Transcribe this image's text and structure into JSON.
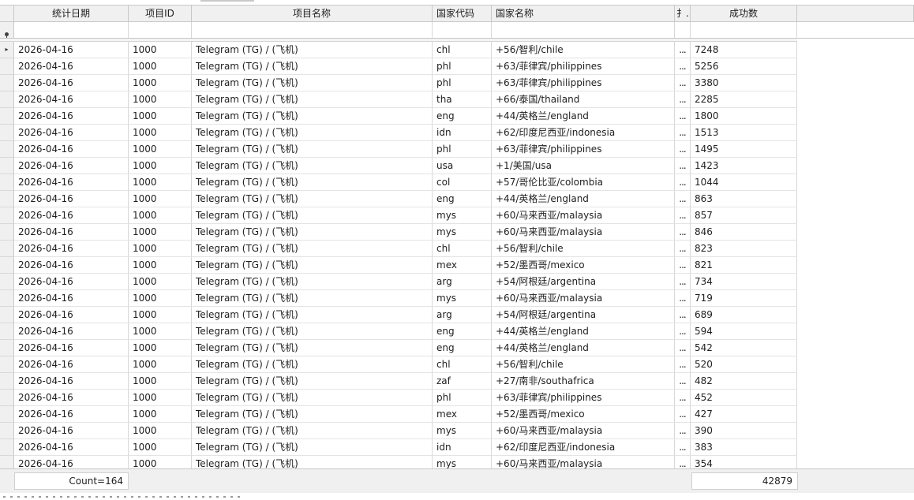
{
  "columns": {
    "date": "统计日期",
    "project_id": "项目ID",
    "project_name": "项目名称",
    "country_code": "国家代码",
    "country_name": "国家名称",
    "truncated": "扌..",
    "success_count": "成功数"
  },
  "rows": [
    {
      "date": "2026-04-16",
      "project_id": "1000",
      "project_name": "Telegram (TG) / (飞机)",
      "country_code": "chl",
      "country_name": "+56/智利/chile",
      "ext": "...",
      "success_count": "7248"
    },
    {
      "date": "2026-04-16",
      "project_id": "1000",
      "project_name": "Telegram (TG) / (飞机)",
      "country_code": "phl",
      "country_name": "+63/菲律宾/philippines",
      "ext": "...",
      "success_count": "5256"
    },
    {
      "date": "2026-04-16",
      "project_id": "1000",
      "project_name": "Telegram (TG) / (飞机)",
      "country_code": "phl",
      "country_name": "+63/菲律宾/philippines",
      "ext": "...",
      "success_count": "3380"
    },
    {
      "date": "2026-04-16",
      "project_id": "1000",
      "project_name": "Telegram (TG) / (飞机)",
      "country_code": "tha",
      "country_name": "+66/泰国/thailand",
      "ext": "...",
      "success_count": "2285"
    },
    {
      "date": "2026-04-16",
      "project_id": "1000",
      "project_name": "Telegram (TG) / (飞机)",
      "country_code": "eng",
      "country_name": "+44/英格兰/england",
      "ext": "...",
      "success_count": "1800"
    },
    {
      "date": "2026-04-16",
      "project_id": "1000",
      "project_name": "Telegram (TG) / (飞机)",
      "country_code": "idn",
      "country_name": "+62/印度尼西亚/indonesia",
      "ext": "...",
      "success_count": "1513"
    },
    {
      "date": "2026-04-16",
      "project_id": "1000",
      "project_name": "Telegram (TG) / (飞机)",
      "country_code": "phl",
      "country_name": "+63/菲律宾/philippines",
      "ext": "...",
      "success_count": "1495"
    },
    {
      "date": "2026-04-16",
      "project_id": "1000",
      "project_name": "Telegram (TG) / (飞机)",
      "country_code": "usa",
      "country_name": "+1/美国/usa",
      "ext": "...",
      "success_count": "1423"
    },
    {
      "date": "2026-04-16",
      "project_id": "1000",
      "project_name": "Telegram (TG) / (飞机)",
      "country_code": "col",
      "country_name": "+57/哥伦比亚/colombia",
      "ext": "...",
      "success_count": "1044"
    },
    {
      "date": "2026-04-16",
      "project_id": "1000",
      "project_name": "Telegram (TG) / (飞机)",
      "country_code": "eng",
      "country_name": "+44/英格兰/england",
      "ext": "...",
      "success_count": "863"
    },
    {
      "date": "2026-04-16",
      "project_id": "1000",
      "project_name": "Telegram (TG) / (飞机)",
      "country_code": "mys",
      "country_name": "+60/马来西亚/malaysia",
      "ext": "...",
      "success_count": "857"
    },
    {
      "date": "2026-04-16",
      "project_id": "1000",
      "project_name": "Telegram (TG) / (飞机)",
      "country_code": "mys",
      "country_name": "+60/马来西亚/malaysia",
      "ext": "...",
      "success_count": "846"
    },
    {
      "date": "2026-04-16",
      "project_id": "1000",
      "project_name": "Telegram (TG) / (飞机)",
      "country_code": "chl",
      "country_name": "+56/智利/chile",
      "ext": "...",
      "success_count": "823"
    },
    {
      "date": "2026-04-16",
      "project_id": "1000",
      "project_name": "Telegram (TG) / (飞机)",
      "country_code": "mex",
      "country_name": "+52/墨西哥/mexico",
      "ext": "...",
      "success_count": "821"
    },
    {
      "date": "2026-04-16",
      "project_id": "1000",
      "project_name": "Telegram (TG) / (飞机)",
      "country_code": "arg",
      "country_name": "+54/阿根廷/argentina",
      "ext": "...",
      "success_count": "734"
    },
    {
      "date": "2026-04-16",
      "project_id": "1000",
      "project_name": "Telegram (TG) / (飞机)",
      "country_code": "mys",
      "country_name": "+60/马来西亚/malaysia",
      "ext": "...",
      "success_count": "719"
    },
    {
      "date": "2026-04-16",
      "project_id": "1000",
      "project_name": "Telegram (TG) / (飞机)",
      "country_code": "arg",
      "country_name": "+54/阿根廷/argentina",
      "ext": "...",
      "success_count": "689"
    },
    {
      "date": "2026-04-16",
      "project_id": "1000",
      "project_name": "Telegram (TG) / (飞机)",
      "country_code": "eng",
      "country_name": "+44/英格兰/england",
      "ext": "...",
      "success_count": "594"
    },
    {
      "date": "2026-04-16",
      "project_id": "1000",
      "project_name": "Telegram (TG) / (飞机)",
      "country_code": "eng",
      "country_name": "+44/英格兰/england",
      "ext": "...",
      "success_count": "542"
    },
    {
      "date": "2026-04-16",
      "project_id": "1000",
      "project_name": "Telegram (TG) / (飞机)",
      "country_code": "chl",
      "country_name": "+56/智利/chile",
      "ext": "...",
      "success_count": "520"
    },
    {
      "date": "2026-04-16",
      "project_id": "1000",
      "project_name": "Telegram (TG) / (飞机)",
      "country_code": "zaf",
      "country_name": "+27/南非/southafrica",
      "ext": "...",
      "success_count": "482"
    },
    {
      "date": "2026-04-16",
      "project_id": "1000",
      "project_name": "Telegram (TG) / (飞机)",
      "country_code": "phl",
      "country_name": "+63/菲律宾/philippines",
      "ext": "...",
      "success_count": "452"
    },
    {
      "date": "2026-04-16",
      "project_id": "1000",
      "project_name": "Telegram (TG) / (飞机)",
      "country_code": "mex",
      "country_name": "+52/墨西哥/mexico",
      "ext": "...",
      "success_count": "427"
    },
    {
      "date": "2026-04-16",
      "project_id": "1000",
      "project_name": "Telegram (TG) / (飞机)",
      "country_code": "mys",
      "country_name": "+60/马来西亚/malaysia",
      "ext": "...",
      "success_count": "390"
    },
    {
      "date": "2026-04-16",
      "project_id": "1000",
      "project_name": "Telegram (TG) / (飞机)",
      "country_code": "idn",
      "country_name": "+62/印度尼西亚/indonesia",
      "ext": "...",
      "success_count": "383"
    },
    {
      "date": "2026-04-16",
      "project_id": "1000",
      "project_name": "Telegram (TG) / (飞机)",
      "country_code": "mys",
      "country_name": "+60/马来西亚/malaysia",
      "ext": "...",
      "success_count": "354"
    }
  ],
  "footer": {
    "count_summary": "Count=164",
    "sum_summary": "42879"
  },
  "indicators": {
    "current_row_icon": "row-pointer-icon",
    "filter_row_icon": "filter-pin-icon"
  }
}
